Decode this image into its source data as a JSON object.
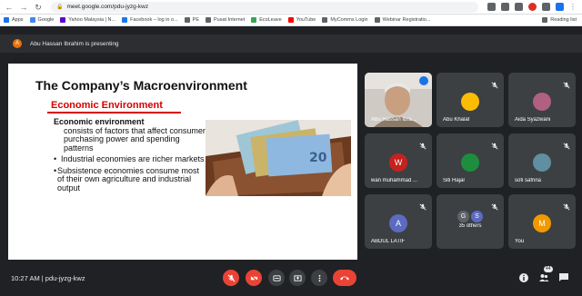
{
  "browser": {
    "url": "meet.google.com/pdu-jyzg-kwz",
    "bookmarks": [
      {
        "label": "Apps",
        "color": "#1a73e8"
      },
      {
        "label": "Google",
        "color": "#4285f4"
      },
      {
        "label": "Yahoo Malaysia | N...",
        "color": "#6001d2"
      },
      {
        "label": "Facebook – log in o...",
        "color": "#1877f2"
      },
      {
        "label": "PE",
        "color": "#5f6368"
      },
      {
        "label": "Pusat Internet",
        "color": "#5f6368"
      },
      {
        "label": "EcoLeave",
        "color": "#34a853"
      },
      {
        "label": "YouTube",
        "color": "#ff0000"
      },
      {
        "label": "MyComms Login",
        "color": "#5f6368"
      },
      {
        "label": "Webinar Registratio...",
        "color": "#5f6368"
      }
    ],
    "reading_list": "Reading list"
  },
  "meet": {
    "presenter_initial": "A",
    "presenting_text": "Abu Hassan Ibrahim is presenting",
    "slide": {
      "title": "The Company’s Macroenvironment",
      "subtitle": "Economic Environment",
      "heading": "Economic environment",
      "heading_detail": "consists of factors that affect consumer purchasing power and spending patterns",
      "bullets": [
        "Industrial economies are richer markets",
        "Subsistence economies consume most of their own agriculture and industrial output"
      ]
    },
    "participants": [
      {
        "name": "Abu Hassan Ibra...",
        "type": "video",
        "speaking": true
      },
      {
        "name": "Abu Khalaf",
        "type": "photo",
        "color": "#fbbc04"
      },
      {
        "name": "Aida Syazwani",
        "type": "photo",
        "color": "#b06080"
      },
      {
        "name": "wan muhammad ...",
        "type": "initial",
        "initial": "W",
        "color": "#c5221f"
      },
      {
        "name": "Siti Hajar",
        "type": "photo",
        "color": "#1e8e3e"
      },
      {
        "name": "sofi safrina",
        "type": "photo",
        "color": "#5f8fa0"
      },
      {
        "name": "ABDUL LATIF",
        "type": "initial",
        "initial": "A",
        "color": "#5c6bc0"
      },
      {
        "name": "35 others",
        "type": "group",
        "initials": [
          "G",
          "S"
        ],
        "colors": [
          "#5f6368",
          "#5c6bc0"
        ]
      },
      {
        "name": "You",
        "type": "initial",
        "initial": "M",
        "color": "#f29900"
      }
    ],
    "time_code": "10:27 AM  |  pdu-jyzg-kwz",
    "participant_count": "44"
  },
  "colors": {
    "accent_red": "#ea4335",
    "slide_red": "#d50000",
    "tile_bg": "#3c4043"
  }
}
